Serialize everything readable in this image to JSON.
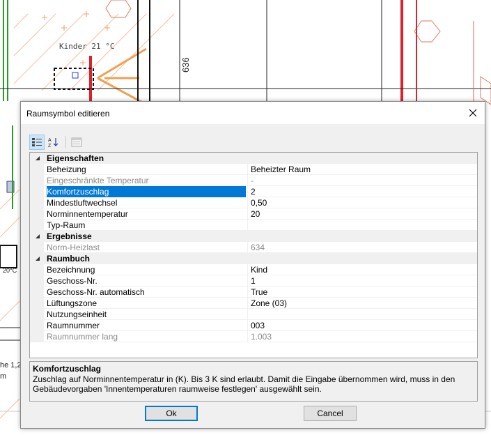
{
  "background": {
    "room_label": "Kinder 21 °C",
    "dimension": "636",
    "left_text_1": "he 1,2",
    "left_text_2": "m",
    "left_temp": "20°C"
  },
  "dialog": {
    "title": "Raumsymbol editieren",
    "toolbar": [
      {
        "name": "categorized-view-icon",
        "active": true
      },
      {
        "name": "alphabetical-sort-icon",
        "active": false
      },
      {
        "name": "property-pages-icon",
        "active": false
      }
    ],
    "categories": [
      {
        "label": "Eigenschaften",
        "rows": [
          {
            "name": "Beheizung",
            "value": "Beheizter Raum",
            "disabled": false,
            "selected": false
          },
          {
            "name": "Eingeschränkte Temperatur",
            "value": "-",
            "disabled": true,
            "selected": false
          },
          {
            "name": "Komfortzuschlag",
            "value": "2",
            "disabled": false,
            "selected": true
          },
          {
            "name": "Mindestluftwechsel",
            "value": "0,50",
            "disabled": false,
            "selected": false
          },
          {
            "name": "Norminnentemperatur",
            "value": "20",
            "disabled": false,
            "selected": false
          },
          {
            "name": "Typ-Raum",
            "value": "",
            "disabled": false,
            "selected": false
          }
        ]
      },
      {
        "label": "Ergebnisse",
        "rows": [
          {
            "name": "Norm-Heizlast",
            "value": "634",
            "disabled": true,
            "selected": false
          }
        ]
      },
      {
        "label": "Raumbuch",
        "rows": [
          {
            "name": "Bezeichnung",
            "value": "Kind",
            "disabled": false,
            "selected": false
          },
          {
            "name": "Geschoss-Nr.",
            "value": "1",
            "disabled": false,
            "selected": false
          },
          {
            "name": "Geschoss-Nr. automatisch",
            "value": "True",
            "disabled": false,
            "selected": false
          },
          {
            "name": "Lüftungszone",
            "value": "Zone (03)",
            "disabled": false,
            "selected": false
          },
          {
            "name": "Nutzungseinheit",
            "value": "",
            "disabled": false,
            "selected": false
          },
          {
            "name": "Raumnummer",
            "value": "003",
            "disabled": false,
            "selected": false
          },
          {
            "name": "Raumnummer lang",
            "value": "1.003",
            "disabled": true,
            "selected": false
          }
        ]
      }
    ],
    "help": {
      "title": "Komfortzuschlag",
      "text": "Zuschlag auf Norminnentemperatur in (K). Bis 3 K sind erlaubt. Damit die Eingabe übernommen wird, muss in den Gebäudevorgaben 'Innentemperaturen raumweise festlegen' ausgewählt sein."
    },
    "ok_label": "Ok",
    "cancel_label": "Cancel"
  },
  "colors": {
    "selection": "#0078d7",
    "cad_red": "#e0202a",
    "cad_orange": "#f0a050",
    "cad_green": "#20a020"
  }
}
